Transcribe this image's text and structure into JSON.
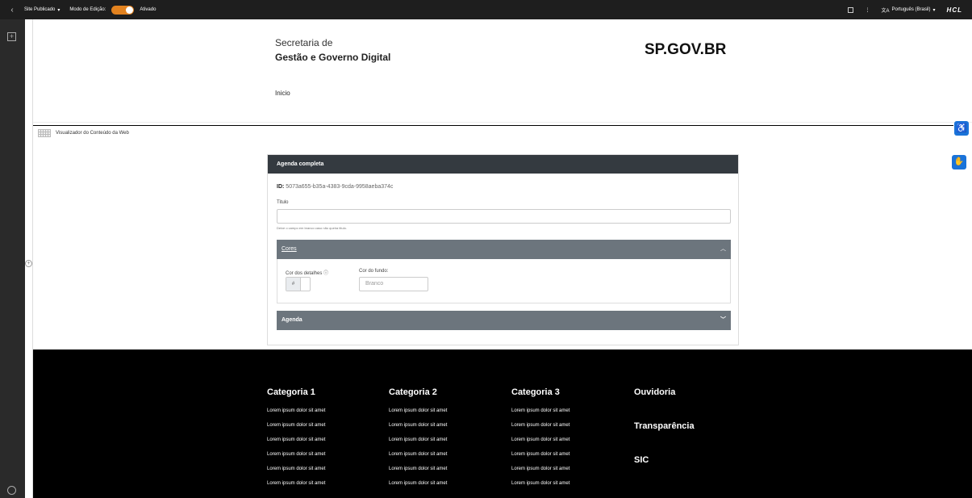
{
  "topbar": {
    "back": "‹",
    "site_status": "Site Publicado",
    "site_status_chevron": "▾",
    "edit_mode_label": "Modo de Edição:",
    "edit_mode_state": "Ativado",
    "language": "Português (Brasil)",
    "language_chevron": "▾",
    "brand": "HCL",
    "more": "⋮"
  },
  "header": {
    "secretaria_line1": "Secretaria de",
    "secretaria_line2": "Gestão e Governo Digital",
    "logo_mark": "SP",
    "logo_text": ".GOV.BR",
    "nav_inicio": "Inicio"
  },
  "portlet": {
    "title": "Visualizador do Conteúdo da Web"
  },
  "card": {
    "title": "Agenda completa",
    "id_label": "ID:",
    "id_value": "5073a655-b35a-4383-9cda-9958aeba374c",
    "titulo_label": "Titulo",
    "titulo_value": "",
    "titulo_hint": "Deixe o campo em branco caso não queira titulo.",
    "cores_label": "Cores",
    "cor_detalhes_label": "Cor dos detalhes ⓘ",
    "hash": "#",
    "cor_fundo_label": "Cor do fundo:",
    "cor_fundo_value": "Branco",
    "agenda_label": "Agenda"
  },
  "footer": {
    "columns": [
      {
        "title": "Categoria 1",
        "links": [
          "Lorem ipsum dolor sit amet",
          "Lorem ipsum dolor sit amet",
          "Lorem ipsum dolor sit amet",
          "Lorem ipsum dolor sit amet",
          "Lorem ipsum dolor sit amet",
          "Lorem ipsum dolor sit amet"
        ]
      },
      {
        "title": "Categoria 2",
        "links": [
          "Lorem ipsum dolor sit amet",
          "Lorem ipsum dolor sit amet",
          "Lorem ipsum dolor sit amet",
          "Lorem ipsum dolor sit amet",
          "Lorem ipsum dolor sit amet",
          "Lorem ipsum dolor sit amet"
        ]
      },
      {
        "title": "Categoria 3",
        "links": [
          "Lorem ipsum dolor sit amet",
          "Lorem ipsum dolor sit amet",
          "Lorem ipsum dolor sit amet",
          "Lorem ipsum dolor sit amet",
          "Lorem ipsum dolor sit amet",
          "Lorem ipsum dolor sit amet"
        ]
      }
    ],
    "links_right": [
      "Ouvidoria",
      "Transparência",
      "SIC"
    ]
  },
  "colors": {
    "accent_toggle": "#e2821f",
    "accessibility_blue": "#1a73d9",
    "card_header": "#343a40",
    "accordion": "#6c757d"
  },
  "icons": [
    "back-chevron-icon",
    "layout-icon",
    "more-icon",
    "translate-icon",
    "add-icon",
    "globe-icon",
    "expand-icon",
    "grid-icon",
    "accessibility-icon",
    "sign-language-icon",
    "chevron-up-icon",
    "chevron-down-icon",
    "info-icon"
  ]
}
